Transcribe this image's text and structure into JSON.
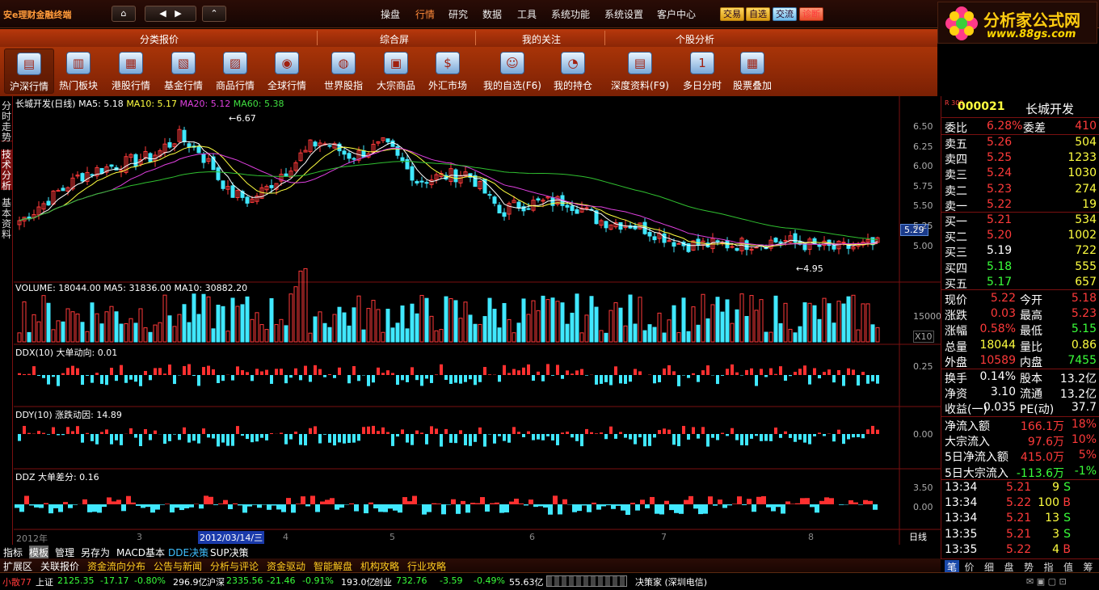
{
  "app_title": "安e理财金融终端",
  "nav": {
    "home": "⌂",
    "back": "◀",
    "fwd": "▶",
    "up": "⌃"
  },
  "menus": [
    "操盘",
    "行情",
    "研究",
    "数据",
    "工具",
    "系统功能",
    "系统设置",
    "客户中心"
  ],
  "quick_buttons": [
    "交易",
    "自选",
    "交流",
    "诊断"
  ],
  "logo": {
    "main": "分析家公式网",
    "url": "www.88gs.com"
  },
  "sections": [
    "分类报价",
    "综合屏",
    "我的关注",
    "个股分析"
  ],
  "icons": [
    {
      "label": "沪深行情",
      "glyph": "▤"
    },
    {
      "label": "热门板块",
      "glyph": "▥"
    },
    {
      "label": "港股行情",
      "glyph": "▦"
    },
    {
      "label": "基金行情",
      "glyph": "▧"
    },
    {
      "label": "商品行情",
      "glyph": "▨"
    },
    {
      "label": "全球行情",
      "glyph": "◉"
    },
    {
      "label": "世界股指",
      "glyph": "◍"
    },
    {
      "label": "大宗商品",
      "glyph": "▣"
    },
    {
      "label": "外汇市场",
      "glyph": "$"
    },
    {
      "label": "我的自选(F6)",
      "glyph": "☺"
    },
    {
      "label": "我的持仓",
      "glyph": "◔"
    },
    {
      "label": "深度资料(F9)",
      "glyph": "▤"
    },
    {
      "label": "多日分时",
      "glyph": "1"
    },
    {
      "label": "股票叠加",
      "glyph": "▦"
    }
  ],
  "left_tabs": [
    "分时走势",
    "技术分析",
    "基本资料"
  ],
  "ma_legend": {
    "title": "长城开发(日线)",
    "ma5": "MA5: 5.18",
    "ma10": "MA10: 5.17",
    "ma20": "MA20: 5.12",
    "ma60": "MA60: 5.38"
  },
  "price_axis": [
    "6.50",
    "6.25",
    "6.00",
    "5.75",
    "5.50",
    "5.25",
    "5.00"
  ],
  "current_price_tag": "5.29",
  "high_mark": "6.67",
  "low_mark": "4.95",
  "volume_legend": "VOLUME: 18044.00  MA5: 31836.00  MA10: 30882.20",
  "volume_axis": [
    "15000",
    "X10"
  ],
  "ddx_legend": "DDX(10)  大单动向: 0.01",
  "ddx_axis": "0.25",
  "ddy_legend": "DDY(10)  涨跌动因: 14.89",
  "ddy_axis": "0.00",
  "ddz_legend": "DDZ  大单差分: 0.16",
  "ddz_axis": [
    "3.50",
    "0.00"
  ],
  "date_axis": [
    "2012年",
    "3",
    "4",
    "5",
    "6",
    "7",
    "8"
  ],
  "date_cursor": "2012/03/14/三",
  "period": "日线",
  "zoom": [
    "+",
    "-",
    "⇔"
  ],
  "stock": {
    "code": "000021",
    "name": "长城开发",
    "index_tag": "R 300"
  },
  "weibi": {
    "l1": "委比",
    "v1": "6.28%",
    "l2": "委差",
    "v2": "410"
  },
  "asks": [
    [
      "卖五",
      "5.26",
      "504"
    ],
    [
      "卖四",
      "5.25",
      "1233"
    ],
    [
      "卖三",
      "5.24",
      "1030"
    ],
    [
      "卖二",
      "5.23",
      "274"
    ],
    [
      "卖一",
      "5.22",
      "19"
    ]
  ],
  "bids": [
    [
      "买一",
      "5.21",
      "534"
    ],
    [
      "买二",
      "5.20",
      "1002"
    ],
    [
      "买三",
      "5.19",
      "722"
    ],
    [
      "买四",
      "5.18",
      "555"
    ],
    [
      "买五",
      "5.17",
      "657"
    ]
  ],
  "stats": [
    [
      "现价",
      "5.22",
      "今开",
      "5.18"
    ],
    [
      "涨跌",
      "0.03",
      "最高",
      "5.23"
    ],
    [
      "涨幅",
      "0.58%",
      "最低",
      "5.15"
    ],
    [
      "总量",
      "18044",
      "量比",
      "0.86"
    ],
    [
      "外盘",
      "10589",
      "内盘",
      "7455"
    ]
  ],
  "stats2": [
    [
      "换手",
      "0.14%",
      "股本",
      "13.2亿"
    ],
    [
      "净资",
      "3.10",
      "流通",
      "13.2亿"
    ],
    [
      "收益(一)",
      "0.035",
      "PE(动)",
      "37.7"
    ]
  ],
  "flows": [
    [
      "净流入额",
      "166.1万",
      "18%"
    ],
    [
      "大宗流入",
      "97.6万",
      "10%"
    ],
    [
      "5日净流入额",
      "415.0万",
      "5%"
    ],
    [
      "5日大宗流入",
      "-113.6万",
      "-1%"
    ]
  ],
  "ticks": [
    [
      "13:34",
      "5.21",
      "9",
      "S"
    ],
    [
      "13:34",
      "5.22",
      "100",
      "B"
    ],
    [
      "13:34",
      "5.21",
      "13",
      "S"
    ],
    [
      "13:35",
      "5.21",
      "3",
      "S"
    ],
    [
      "13:35",
      "5.22",
      "4",
      "B"
    ]
  ],
  "right_tabs": [
    "笔",
    "价",
    "细",
    "盘",
    "势",
    "指",
    "值",
    "筹"
  ],
  "bottom_tabs1": [
    "指标",
    "模板",
    "管理",
    "另存为",
    "MACD基本",
    "DDE决策",
    "SUP决策"
  ],
  "bottom_tabs2": [
    "扩展区",
    "关联报价",
    "资金流向分布",
    "公告与新闻",
    "分析与评论",
    "资金驱动",
    "智能解盘",
    "机构攻略",
    "行业攻略"
  ],
  "ticker": {
    "user": "小散77",
    "sh_label": "上证",
    "sh": "2125.35",
    "sh_chg": "-17.17",
    "sh_pct": "-0.80%",
    "sh_amt": "296.9亿",
    "hs_label": "沪深",
    "hs": "2335.56",
    "hs_chg": "-21.46",
    "hs_pct": "-0.91%",
    "hs_amt": "193.0亿",
    "cy_label": "创业",
    "cy": "732.76",
    "cy_chg": "-3.59",
    "cy_pct": "-0.49%",
    "cy_amt": "55.63亿",
    "msg": "决策家 (深圳电信)"
  }
}
